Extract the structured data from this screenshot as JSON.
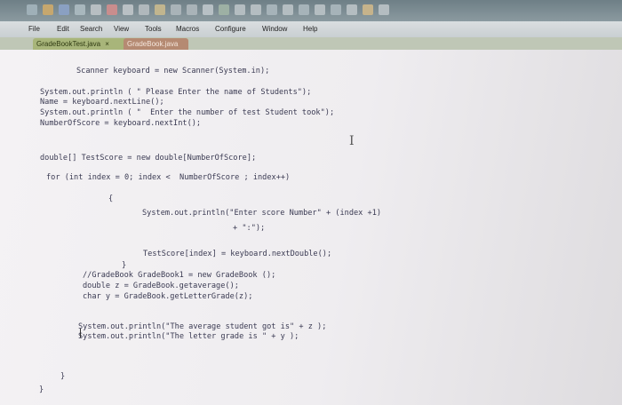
{
  "menu": [
    "File",
    "Edit",
    "Search",
    "View",
    "Tools",
    "Macros",
    "Configure",
    "Window",
    "Help"
  ],
  "tabs": {
    "active": "GradeBookTest.java",
    "close": "×",
    "inactive": "GradeBook.java"
  },
  "code": [
    "Scanner keyboard = new Scanner(System.in);",
    "System.out.println ( \" Please Enter the name of Students\");",
    "Name = keyboard.nextLine();",
    "System.out.println ( \"  Enter the number of test Student took\");",
    "NumberOfScore = keyboard.nextInt();",
    "double[] TestScore = new double[NumberOfScore];",
    "for (int index = 0; index <  NumberOfScore ; index++)",
    "{",
    "System.out.println(\"Enter score Number\" + (index +1)",
    "+ \":\");",
    "TestScore[index] = keyboard.nextDouble();",
    "}",
    "//GradeBook GradeBook1 = new GradeBook ();",
    "double z = GradeBook.getaverage();",
    "char y = GradeBook.getLetterGrade(z);",
    "System.out.println(\"The average student got is\" + z );",
    "System.out.println(\"The letter grade is \" + y );",
    "}"
  ]
}
